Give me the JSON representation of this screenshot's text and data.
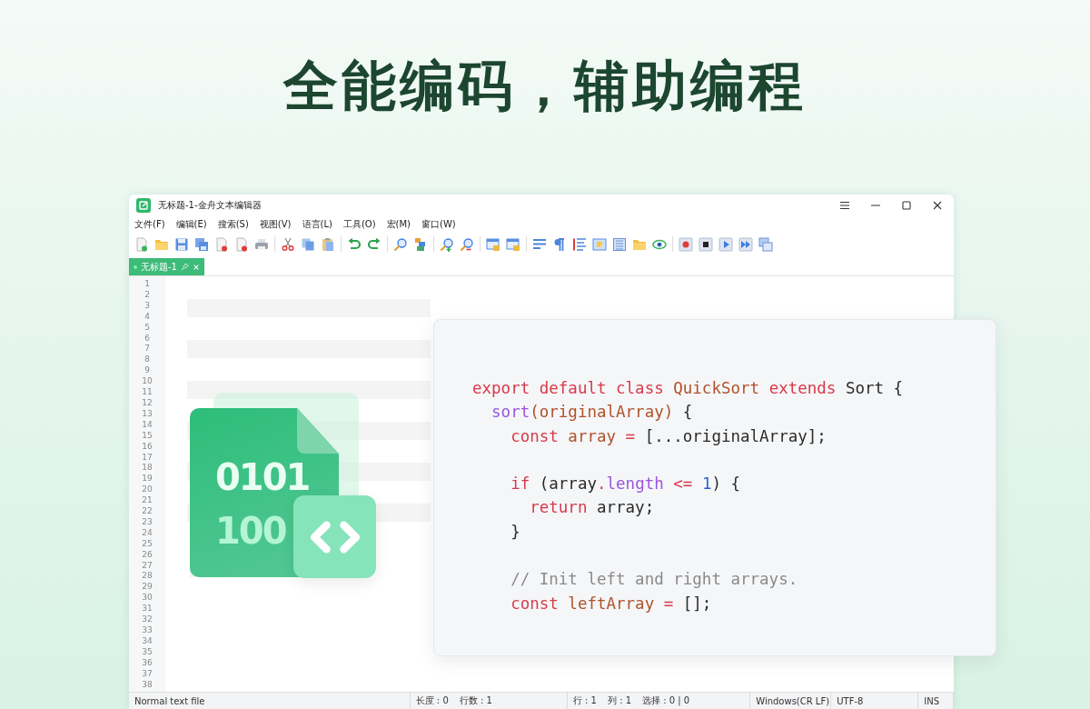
{
  "headline": "全能编码，辅助编程",
  "window": {
    "title": "无标题-1-金舟文本编辑器"
  },
  "menu": [
    "文件(F)",
    "编辑(E)",
    "搜索(S)",
    "视图(V)",
    "语言(L)",
    "工具(O)",
    "宏(M)",
    "窗口(W)"
  ],
  "tabs": [
    {
      "label": "无标题-1",
      "selected": true
    }
  ],
  "line_numbers": [
    "1",
    "2",
    "3",
    "4",
    "5",
    "6",
    "7",
    "8",
    "9",
    "10",
    "11",
    "12",
    "13",
    "14",
    "15",
    "16",
    "17",
    "18",
    "19",
    "20",
    "21",
    "22",
    "23",
    "24",
    "25",
    "26",
    "27",
    "28",
    "29",
    "30",
    "31",
    "32",
    "33",
    "34",
    "35",
    "36",
    "37",
    "38"
  ],
  "status_bar": {
    "file_type": "Normal text file",
    "length": "长度 : 0",
    "lines": "行数 : 1",
    "row": "行 : 1",
    "column": "列 : 1",
    "selection": "选择 : 0 | 0",
    "line_ending": "Windows(CR LF)",
    "encoding": "UTF-8",
    "mode": "INS"
  },
  "illustration": {
    "lines": [
      "0101",
      "100"
    ]
  },
  "code_card": {
    "lines": [
      {
        "kind": "code",
        "tokens": [
          {
            "kind": "keyword",
            "text": "export default class "
          },
          {
            "kind": "name",
            "text": "QuickSort "
          },
          {
            "kind": "keyword",
            "text": "extends "
          },
          {
            "kind": "plain",
            "text": "Sort {"
          }
        ]
      },
      {
        "kind": "code",
        "tokens": [
          {
            "kind": "method",
            "text": "  sort"
          },
          {
            "kind": "name",
            "text": "(originalArray)"
          },
          {
            "kind": "plain",
            "text": " {"
          }
        ]
      },
      {
        "kind": "code",
        "tokens": [
          {
            "kind": "keyword",
            "text": "    const "
          },
          {
            "kind": "name",
            "text": "array "
          },
          {
            "kind": "keyword",
            "text": "= "
          },
          {
            "kind": "plain",
            "text": "[...originalArray];"
          }
        ]
      },
      {
        "kind": "blank"
      },
      {
        "kind": "code",
        "tokens": [
          {
            "kind": "keyword",
            "text": "    if "
          },
          {
            "kind": "plain",
            "text": "(array"
          },
          {
            "kind": "keyword",
            "text": "."
          },
          {
            "kind": "method",
            "text": "length "
          },
          {
            "kind": "keyword",
            "text": "<= "
          },
          {
            "kind": "number",
            "text": "1"
          },
          {
            "kind": "plain",
            "text": ") {"
          }
        ]
      },
      {
        "kind": "code",
        "tokens": [
          {
            "kind": "keyword",
            "text": "      return "
          },
          {
            "kind": "plain",
            "text": "array;"
          }
        ]
      },
      {
        "kind": "code",
        "tokens": [
          {
            "kind": "plain",
            "text": "    }"
          }
        ]
      },
      {
        "kind": "blank"
      },
      {
        "kind": "code",
        "tokens": [
          {
            "kind": "comment",
            "text": "    // Init left and right arrays."
          }
        ]
      },
      {
        "kind": "code",
        "tokens": [
          {
            "kind": "keyword",
            "text": "    const "
          },
          {
            "kind": "name",
            "text": "leftArray "
          },
          {
            "kind": "keyword",
            "text": "= "
          },
          {
            "kind": "plain",
            "text": "[];"
          }
        ]
      }
    ]
  }
}
